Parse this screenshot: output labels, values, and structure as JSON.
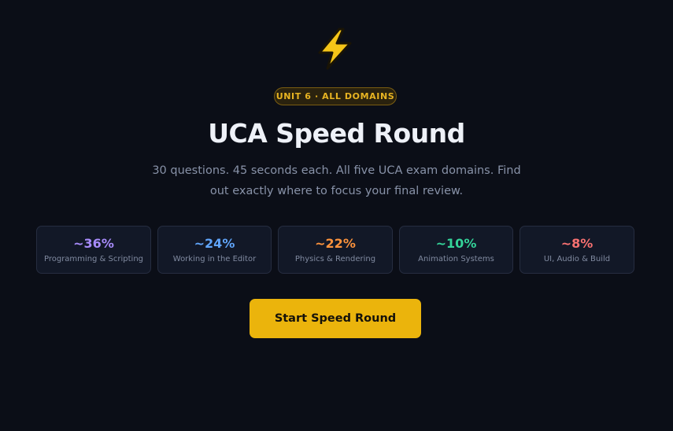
{
  "hero": {
    "icon": "lightning-bolt-icon",
    "badge": "UNIT 6 · ALL DOMAINS",
    "title": "UCA Speed Round",
    "subtitle": "30 questions. 45 seconds each. All five UCA exam domains. Find out exactly where to focus your final review."
  },
  "domains": [
    {
      "percent": "~36%",
      "label": "Programming & Scripting",
      "color": "#a78bfa"
    },
    {
      "percent": "~24%",
      "label": "Working in the Editor",
      "color": "#60a5fa"
    },
    {
      "percent": "~22%",
      "label": "Physics & Rendering",
      "color": "#fb923c"
    },
    {
      "percent": "~10%",
      "label": "Animation Systems",
      "color": "#34d399"
    },
    {
      "percent": "~8%",
      "label": "UI, Audio & Build",
      "color": "#f87171"
    }
  ],
  "start_button": {
    "label": "Start Speed Round",
    "color": "#ebb40c"
  }
}
